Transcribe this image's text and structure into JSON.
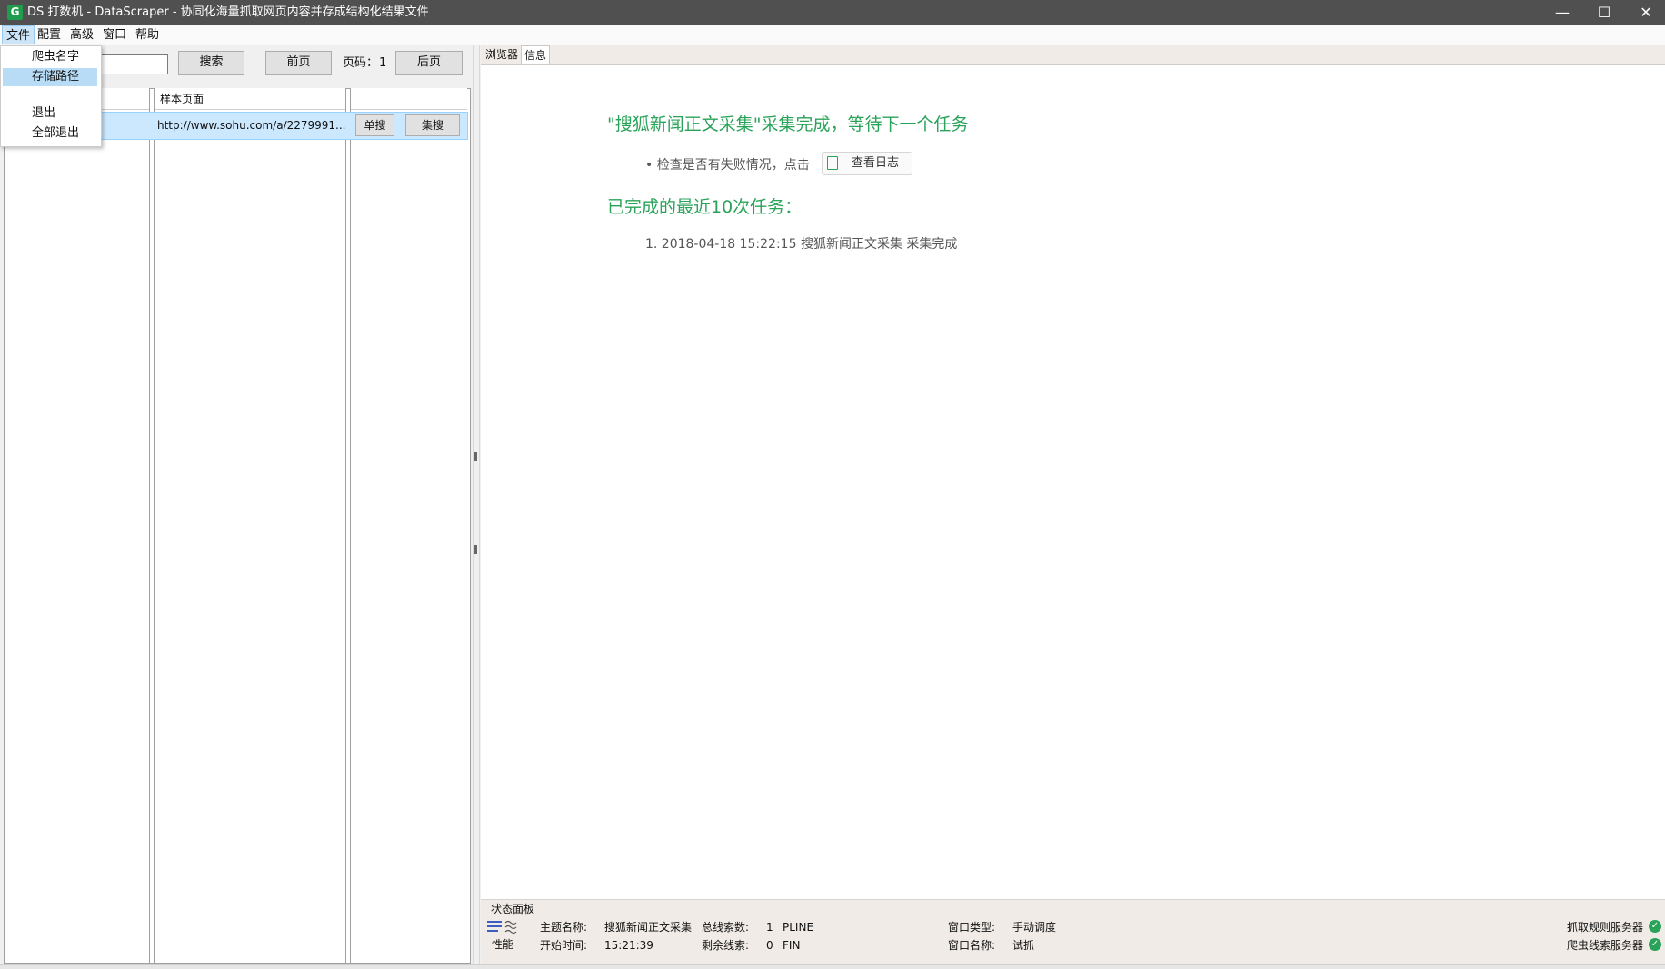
{
  "window": {
    "app_icon_letter": "G",
    "title": "DS 打数机 - DataScraper - 协同化海量抓取网页内容并存成结构化结果文件",
    "minimize": "—",
    "maximize": "☐",
    "close": "✕"
  },
  "menubar": {
    "items": [
      "文件",
      "配置",
      "高级",
      "窗口",
      "帮助"
    ]
  },
  "file_menu": {
    "items": [
      "爬虫名字",
      "存储路径",
      "退出",
      "全部退出"
    ],
    "highlighted": "存储路径"
  },
  "left_panel": {
    "search_button": "搜索",
    "prev_button": "前页",
    "page_label": "页码：",
    "page_number": "1",
    "next_button": "后页",
    "table": {
      "columns": [
        "",
        "样本页面",
        ""
      ],
      "rows": [
        {
          "sample_page": "http://www.sohu.com/a/2279991...",
          "single_search": "单搜",
          "batch_search": "集搜"
        }
      ]
    }
  },
  "right_panel": {
    "tabs": [
      "浏览器",
      "信息"
    ],
    "active_tab": "信息",
    "info": {
      "heading": "\"搜狐新闻正文采集\"采集完成，等待下一个任务",
      "check_text": "• 检查是否有失败情况，点击",
      "log_button": "查看日志",
      "recent_heading": "已完成的最近10次任务：",
      "recent_tasks": [
        "1. 2018-04-18 15:22:15 搜狐新闻正文采集 采集完成"
      ]
    }
  },
  "status_panel": {
    "title": "状态面板",
    "perf_label": "性能",
    "theme_name_label": "主题名称:",
    "theme_name": "搜狐新闻正文采集",
    "start_time_label": "开始时间:",
    "start_time": "15:21:39",
    "total_clues_label": "总线索数:",
    "total_clues": "1",
    "total_clues_tag": "PLINE",
    "remaining_clues_label": "剩余线索:",
    "remaining_clues": "0",
    "remaining_clues_tag": "FIN",
    "window_type_label": "窗口类型:",
    "window_type": "手动调度",
    "window_name_label": "窗口名称:",
    "window_name": "试抓",
    "server_rules": "抓取规则服务器",
    "server_clues": "爬虫线索服务器",
    "ok_glyph": "✓"
  },
  "colors": {
    "accent_green": "#2aa35a",
    "selection": "#cce8ff",
    "titlebar": "#505050"
  }
}
